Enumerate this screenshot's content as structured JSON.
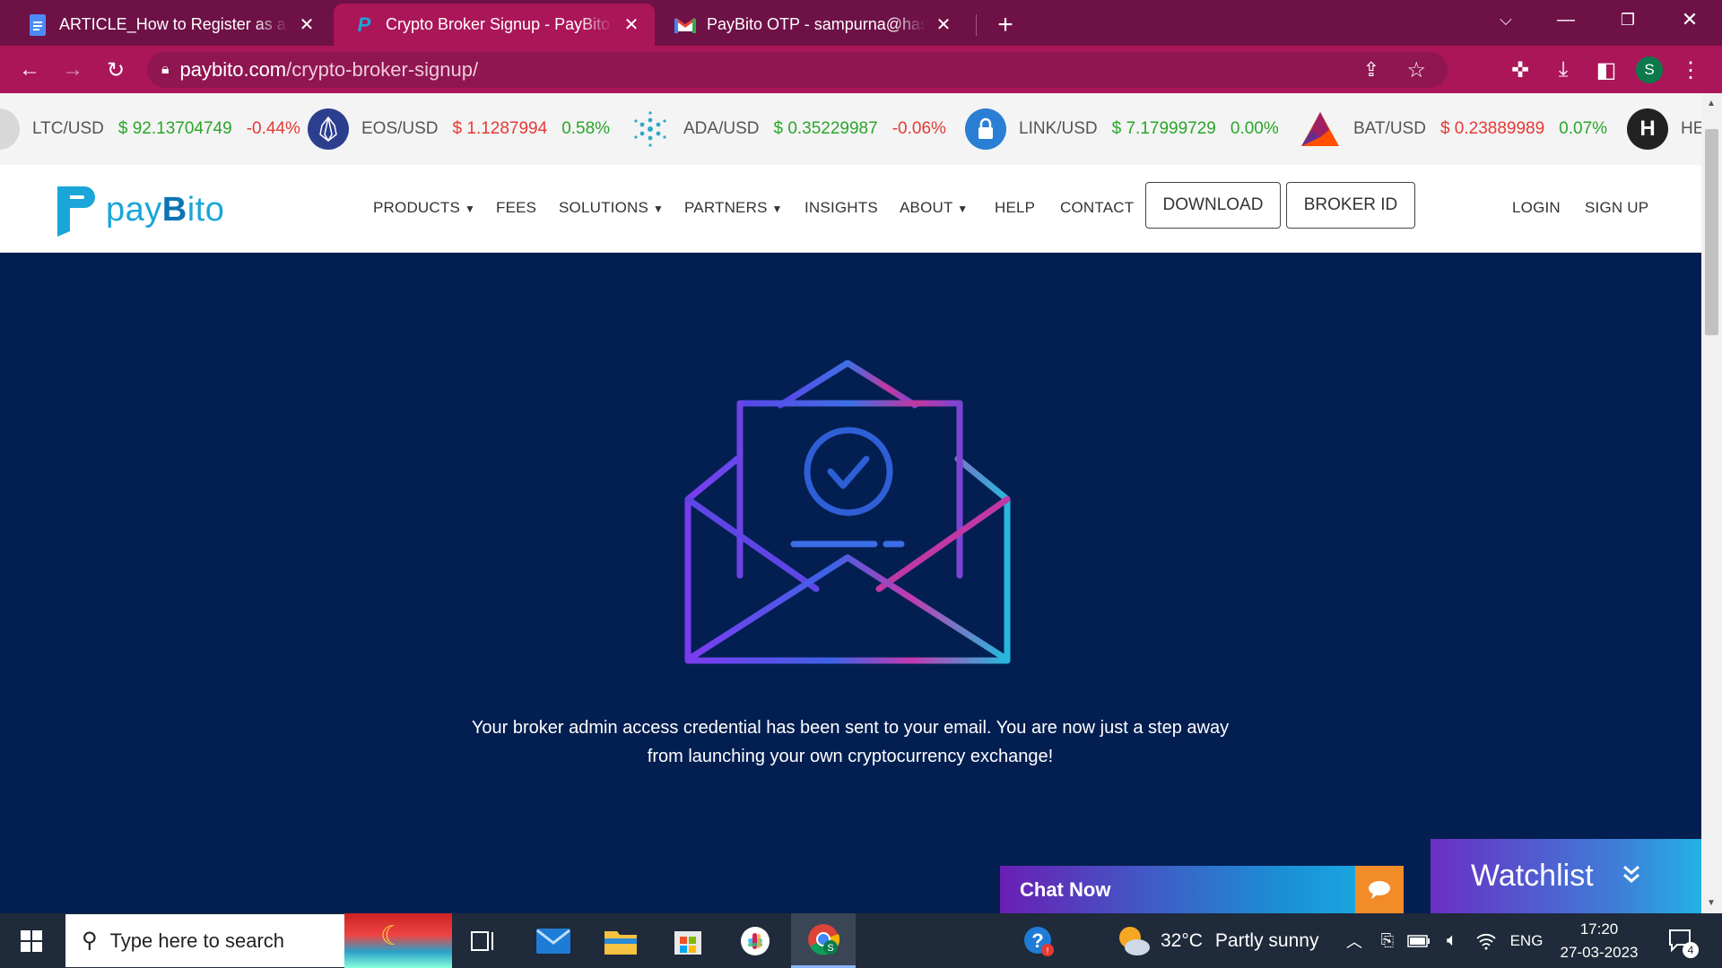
{
  "browser": {
    "tabs": [
      {
        "title": "ARTICLE_How to Register as a Br",
        "icon": "docs-icon"
      },
      {
        "title": "Crypto Broker Signup - PayBito",
        "icon": "paybito-icon",
        "active": true
      },
      {
        "title": "PayBito OTP - sampurna@hashca",
        "icon": "gmail-icon"
      }
    ],
    "new_tab": "+",
    "url_domain": "paybito.com",
    "url_path": "/crypto-broker-signup/",
    "profile_initial": "S"
  },
  "ticker": [
    {
      "symbol": "LTC/USD",
      "price": "$ 92.13704749",
      "change": "-0.44%",
      "price_color": "#2aa52a",
      "change_color": "#e53935"
    },
    {
      "symbol": "EOS/USD",
      "price": "$ 1.1287994",
      "change": "0.58%",
      "price_color": "#e53935",
      "change_color": "#2aa52a"
    },
    {
      "symbol": "ADA/USD",
      "price": "$ 0.35229987",
      "change": "-0.06%",
      "price_color": "#2aa52a",
      "change_color": "#e53935"
    },
    {
      "symbol": "LINK/USD",
      "price": "$ 7.17999729",
      "change": "0.00%",
      "price_color": "#2aa52a",
      "change_color": "#2aa52a"
    },
    {
      "symbol": "BAT/USD",
      "price": "$ 0.23889989",
      "change": "0.07%",
      "price_color": "#e53935",
      "change_color": "#2aa52a"
    },
    {
      "symbol": "HE",
      "price": "",
      "change": "",
      "price_color": "#2aa52a",
      "change_color": "#2aa52a"
    }
  ],
  "site": {
    "logo_left": "pay",
    "logo_b": "B",
    "logo_right": "ito",
    "nav": [
      "PRODUCTS",
      "FEES",
      "SOLUTIONS",
      "PARTNERS",
      "INSIGHTS",
      "ABOUT",
      "HELP",
      "CONTACT"
    ],
    "download": "DOWNLOAD",
    "broker_id": "BROKER ID",
    "login": "LOGIN",
    "signup": "SIGN UP"
  },
  "hero": {
    "message_line1": "Your broker admin access credential has been sent to your email. You are now just a step away",
    "message_line2": "from launching your own cryptocurrency exchange!",
    "bg_color": "#031f51"
  },
  "widgets": {
    "chat": "Chat Now",
    "watchlist": "Watchlist"
  },
  "taskbar": {
    "search_placeholder": "Type here to search",
    "weather_temp": "32°C",
    "weather_desc": "Partly sunny",
    "lang": "ENG",
    "time": "17:20",
    "date": "27-03-2023",
    "notification_count": "4"
  }
}
